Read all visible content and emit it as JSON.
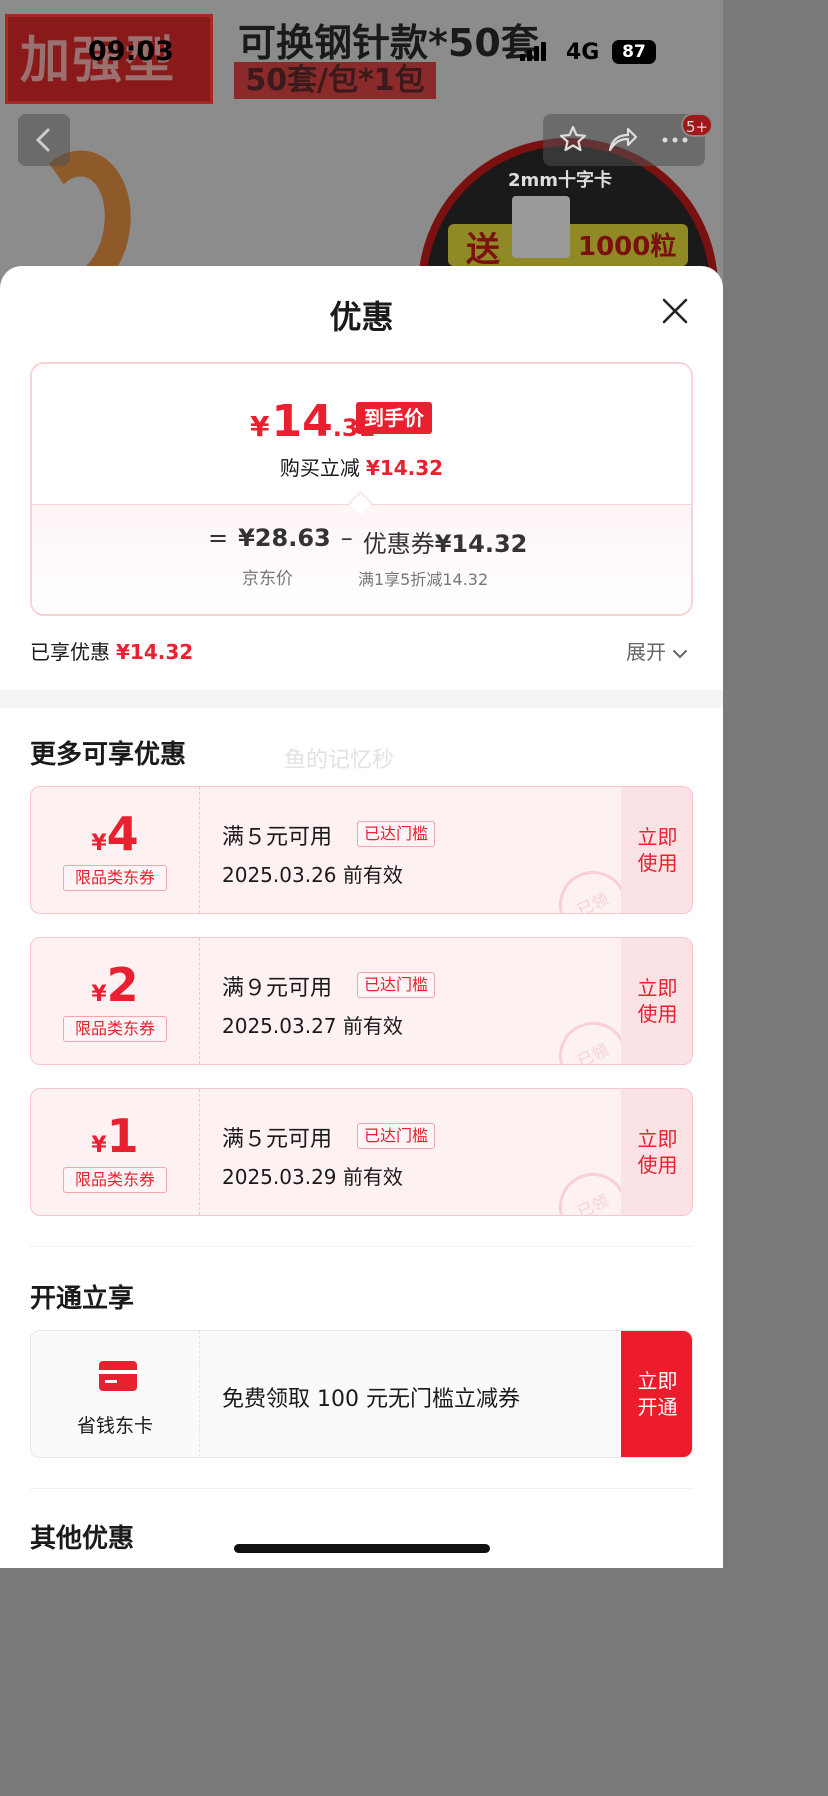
{
  "status_bar": {
    "time": "09:03",
    "network": "4G",
    "battery": "87"
  },
  "banner": {
    "brand_text": "加强型",
    "product_title": "可换钢针款*50套",
    "product_sub": "50套/包*1包",
    "promo_label": "2mm十字卡",
    "promo_send": "送",
    "promo_count": "1000粒",
    "nav_badge": "5+"
  },
  "sheet": {
    "title": "优惠",
    "price_card": {
      "currency": "¥",
      "final_int": "14",
      "final_dec": ".31",
      "final_tag": "到手价",
      "instant_label": "购买立减",
      "instant_value": "¥14.32",
      "formula_eq": "=",
      "jd_price": "¥28.63",
      "minus": "–",
      "coupon_label": "优惠券",
      "coupon_value": "¥14.32",
      "jd_price_label": "京东价",
      "coupon_rule": "满1享5折减14.32"
    },
    "enjoyed": {
      "label": "已享优惠",
      "value": "¥14.32",
      "expand": "展开"
    },
    "more_section": {
      "title": "更多可享优惠",
      "watermark": "鱼的记忆秒"
    },
    "coupons": [
      {
        "currency": "¥",
        "amount": "4",
        "type": "限品类东券",
        "condition": "满５元可用",
        "tag": "已达门槛",
        "expiry": "2025.03.26 前有效",
        "action": "立即使用",
        "stamp": "已领"
      },
      {
        "currency": "¥",
        "amount": "2",
        "type": "限品类东券",
        "condition": "满９元可用",
        "tag": "已达门槛",
        "expiry": "2025.03.27 前有效",
        "action": "立即使用",
        "stamp": "已领"
      },
      {
        "currency": "¥",
        "amount": "1",
        "type": "限品类东券",
        "condition": "满５元可用",
        "tag": "已达门槛",
        "expiry": "2025.03.29 前有效",
        "action": "立即使用",
        "stamp": "已领"
      }
    ],
    "open_section": {
      "title": "开通立享"
    },
    "member": {
      "name": "省钱东卡",
      "desc": "免费领取 100 元无门槛立减券",
      "action": "立即开通"
    },
    "other_section": {
      "title": "其他优惠"
    }
  },
  "colors": {
    "accent": "#e8202f",
    "coupon_bg": "#fdf1f2",
    "border_pink": "#f5c7cb"
  }
}
